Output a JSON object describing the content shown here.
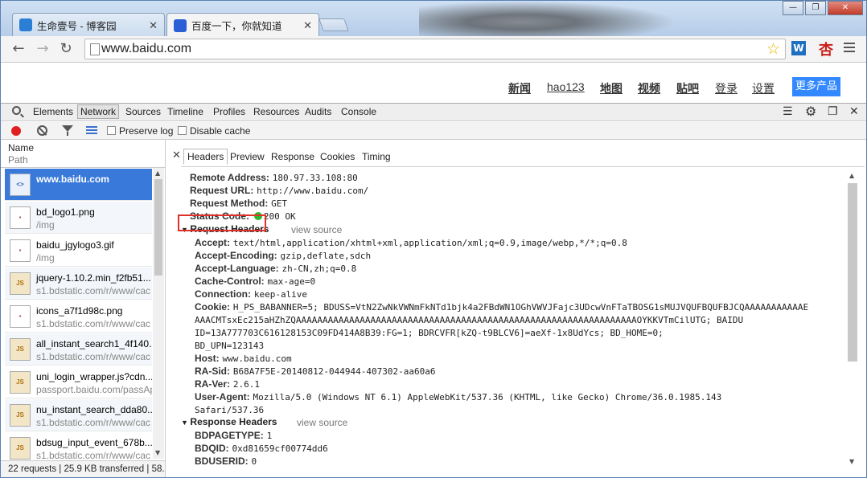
{
  "browser": {
    "tabs": [
      {
        "title": "生命壹号 - 博客园",
        "active": false
      },
      {
        "title": "百度一下，你就知道",
        "active": true
      }
    ],
    "url": "www.baidu.com",
    "ext_w": "W",
    "ext_x": "杏"
  },
  "baidu": {
    "nav": [
      "新闻",
      "hao123",
      "地图",
      "视频",
      "贴吧",
      "登录",
      "设置"
    ],
    "more": "更多产品"
  },
  "devtools": {
    "tabs": [
      "Elements",
      "Network",
      "Sources",
      "Timeline",
      "Profiles",
      "Resources",
      "Audits",
      "Console"
    ],
    "selected_tab": "Network",
    "preserve_log": "Preserve log",
    "disable_cache": "Disable cache",
    "list_header": {
      "name": "Name",
      "path": "Path"
    },
    "requests": [
      {
        "name": "www.baidu.com",
        "path": "",
        "icon": "html-icon"
      },
      {
        "name": "bd_logo1.png",
        "path": "/img",
        "icon": "image-icon"
      },
      {
        "name": "baidu_jgylogo3.gif",
        "path": "/img",
        "icon": "image-icon"
      },
      {
        "name": "jquery-1.10.2.min_f2fb51...",
        "path": "s1.bdstatic.com/r/www/cac",
        "icon": "js-icon"
      },
      {
        "name": "icons_a7f1d98c.png",
        "path": "s1.bdstatic.com/r/www/cac",
        "icon": "image-icon"
      },
      {
        "name": "all_instant_search1_4f140...",
        "path": "s1.bdstatic.com/r/www/cac",
        "icon": "js-icon"
      },
      {
        "name": "uni_login_wrapper.js?cdn...",
        "path": "passport.baidu.com/passAp",
        "icon": "js-icon"
      },
      {
        "name": "nu_instant_search_dda80...",
        "path": "s1.bdstatic.com/r/www/cac",
        "icon": "js-icon"
      },
      {
        "name": "bdsug_input_event_678b...",
        "path": "s1.bdstatic.com/r/www/cac",
        "icon": "js-icon"
      }
    ],
    "status_bar": "22 requests | 25.9 KB transferred | 58...",
    "detail_tabs": [
      "Headers",
      "Preview",
      "Response",
      "Cookies",
      "Timing"
    ],
    "general": [
      {
        "k": "Remote Address:",
        "v": "180.97.33.108:80"
      },
      {
        "k": "Request URL:",
        "v": "http://www.baidu.com/"
      },
      {
        "k": "Request Method:",
        "v": "GET"
      },
      {
        "k": "Status Code:",
        "v": "200 OK"
      }
    ],
    "request_headers_title": "Request Headers",
    "view_source": "view source",
    "request_headers": [
      {
        "k": "Accept:",
        "v": "text/html,application/xhtml+xml,application/xml;q=0.9,image/webp,*/*;q=0.8"
      },
      {
        "k": "Accept-Encoding:",
        "v": "gzip,deflate,sdch"
      },
      {
        "k": "Accept-Language:",
        "v": "zh-CN,zh;q=0.8"
      },
      {
        "k": "Cache-Control:",
        "v": "max-age=0"
      },
      {
        "k": "Connection:",
        "v": "keep-alive"
      },
      {
        "k": "Cookie:",
        "v": "H_PS_BABANNER=5; BDUSS=VtN2ZwNkVWNmFkNTd1bjk4a2FBdWN1OGhVWVJFajc3UDcwVnFTaTBOSG1sMUJVQUFBQUFBJCQAAAAAAAAAAAE"
      },
      {
        "k": "",
        "v": "AAACMTsxEc215aHZhZQAAAAAAAAAAAAAAAAAAAAAAAAAAAAAAAAAAAAAAAAAAAAAAAAAAAAAAAAAAAAAAAAOYKKVTmCilUTG; BAIDU"
      },
      {
        "k": "",
        "v": "ID=13A777703C616128153C09FD414A8B39:FG=1; BDRCVFR[kZQ-t9BLCV6]=aeXf-1x8UdYcs; BD_HOME=0;"
      },
      {
        "k": "",
        "v": "BD_UPN=123143"
      },
      {
        "k": "Host:",
        "v": "www.baidu.com"
      },
      {
        "k": "RA-Sid:",
        "v": "B68A7F5E-20140812-044944-407302-aa60a6"
      },
      {
        "k": "RA-Ver:",
        "v": "2.6.1"
      },
      {
        "k": "User-Agent:",
        "v": "Mozilla/5.0 (Windows NT 6.1) AppleWebKit/537.36 (KHTML, like Gecko) Chrome/36.0.1985.143"
      },
      {
        "k": "",
        "v": "Safari/537.36"
      }
    ],
    "response_headers_title": "Response Headers",
    "response_headers": [
      {
        "k": "BDPAGETYPE:",
        "v": "1"
      },
      {
        "k": "BDQID:",
        "v": "0xd81659cf00774dd6"
      },
      {
        "k": "BDUSERID:",
        "v": "0"
      }
    ]
  }
}
